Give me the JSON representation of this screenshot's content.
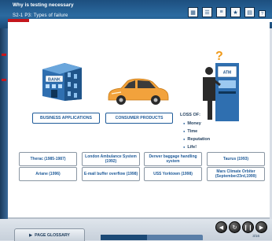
{
  "window": {
    "title": "Why is testing necessary",
    "subtitle": "S2-1 P3: Types of failure"
  },
  "toolbar": {
    "icons": [
      "grid-icon",
      "menu-icon",
      "list-icon",
      "star-icon",
      "book-icon",
      "help-icon"
    ]
  },
  "diagram": {
    "business_label": "BUSINESS APPLICATIONS",
    "consumer_label": "CONSUMER PRODUCTS",
    "bank_sign": "BANK",
    "atm_sign": "ATM",
    "loss_title": "LOSS OF:",
    "loss_items": [
      "Money",
      "Time",
      "Reputation",
      "Life!"
    ]
  },
  "cases": [
    "Therac (1985-1987)",
    "London Ambulance System (1992)",
    "Denver baggage handling system",
    "Taurus (1993)",
    "Ariane (1996)",
    "E-mail buffer overflow (1998)",
    "USS Yorktown (1998)",
    "Mars Climate Orbiter (September23rd,1999)"
  ],
  "footer": {
    "glossary_label": "PAGE GLOSSARY",
    "progress_percent": 45,
    "page_info": "3/16"
  },
  "colors": {
    "header_blue": "#1d4f7f",
    "accent_red": "#c4161c",
    "label_blue": "#1f5b99",
    "car_orange": "#f2a23c"
  }
}
